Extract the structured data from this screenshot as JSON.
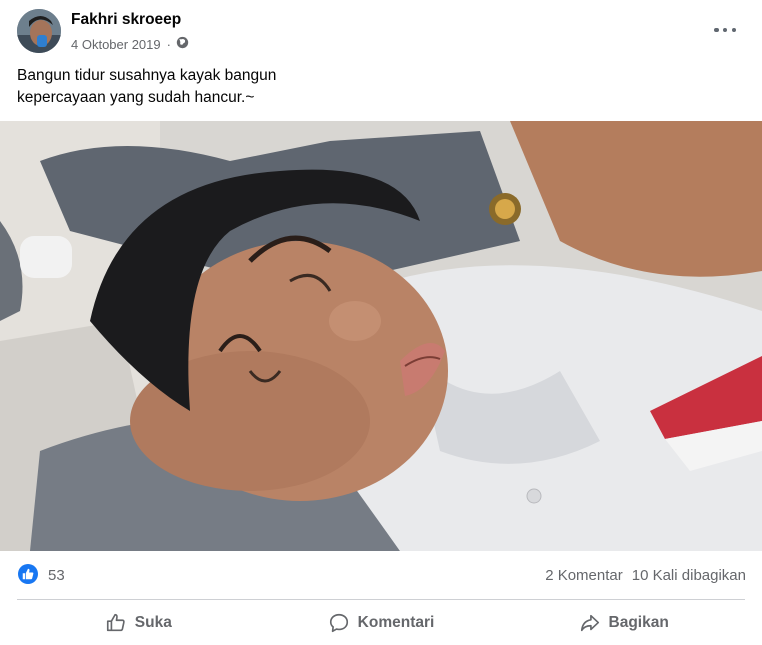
{
  "post": {
    "author": "Fakhri skroeep",
    "date": "4 Oktober 2019",
    "separator": "·",
    "privacy_icon": "globe-icon",
    "caption": "Bangun tidur susahnya kayak bangun\nkepercayaan yang sudah hancur.~",
    "menu_icon": "more-options-icon"
  },
  "stats": {
    "reaction_icon": "like-icon",
    "reaction_count": "53",
    "comments": "2 Komentar",
    "shares": "10 Kali dibagikan"
  },
  "actions": {
    "like_label": "Suka",
    "comment_label": "Komentari",
    "share_label": "Bagikan"
  },
  "colors": {
    "accent": "#1877f2",
    "secondary_text": "#65676b",
    "divider": "#ced0d4"
  }
}
